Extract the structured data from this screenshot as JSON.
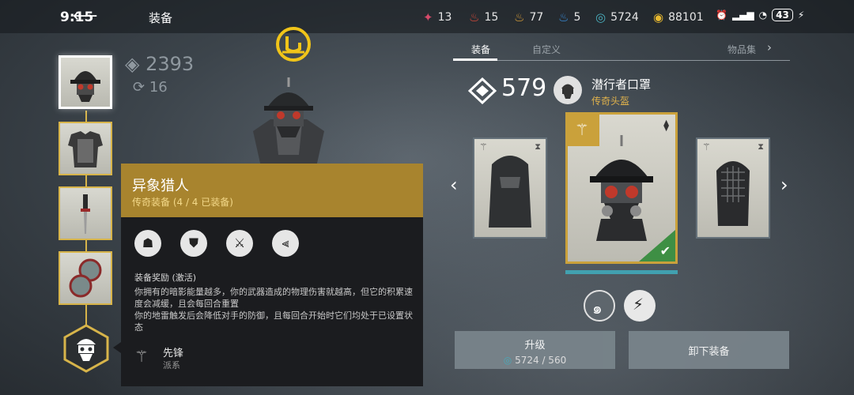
{
  "status_bar": {
    "time": "9:15",
    "battery": "43"
  },
  "header": {
    "title": "装备"
  },
  "resources": [
    {
      "icon": "crystal-icon",
      "value": "13",
      "color": "#d64a6a"
    },
    {
      "icon": "red-flame-icon",
      "value": "15",
      "color": "#e04b3a"
    },
    {
      "icon": "gold-flame-icon",
      "value": "77",
      "color": "#e0a43a"
    },
    {
      "icon": "blue-flame-icon",
      "value": "5",
      "color": "#3a8fe0"
    },
    {
      "icon": "energy-swirl-icon",
      "value": "5724",
      "color": "#4ab0c0"
    },
    {
      "icon": "coin-icon",
      "value": "88101",
      "color": "#e8b930"
    }
  ],
  "left_stats": {
    "power": "2393",
    "level": "16"
  },
  "set_panel": {
    "title": "异象猎人",
    "subtitle": "传奇装备 (4 / 4 已装备)",
    "bonus_label": "装备奖励 (激活)",
    "bonus_text_1": "你拥有的暗影能量越多，你的武器造成的物理伤害就越高，但它的积累速度会减缓，且会每回合重置",
    "bonus_text_2": "你的地雷触发后会降低对手的防御，且每回合开始时它们均处于已设置状态",
    "faction_name": "先锋",
    "faction_label": "派系"
  },
  "tabs": {
    "equip": "装备",
    "custom": "自定义",
    "collection": "物品集"
  },
  "item": {
    "power": "579",
    "name": "潜行者口罩",
    "type": "传奇头盔"
  },
  "buttons": {
    "upgrade": "升级",
    "upgrade_cost": "5724 / 560",
    "unequip": "卸下装备"
  },
  "accent_colors": {
    "legendary_gold": "#caa13b",
    "equipped_green": "#3e8f44",
    "energy_cyan": "#3fb3c4"
  }
}
